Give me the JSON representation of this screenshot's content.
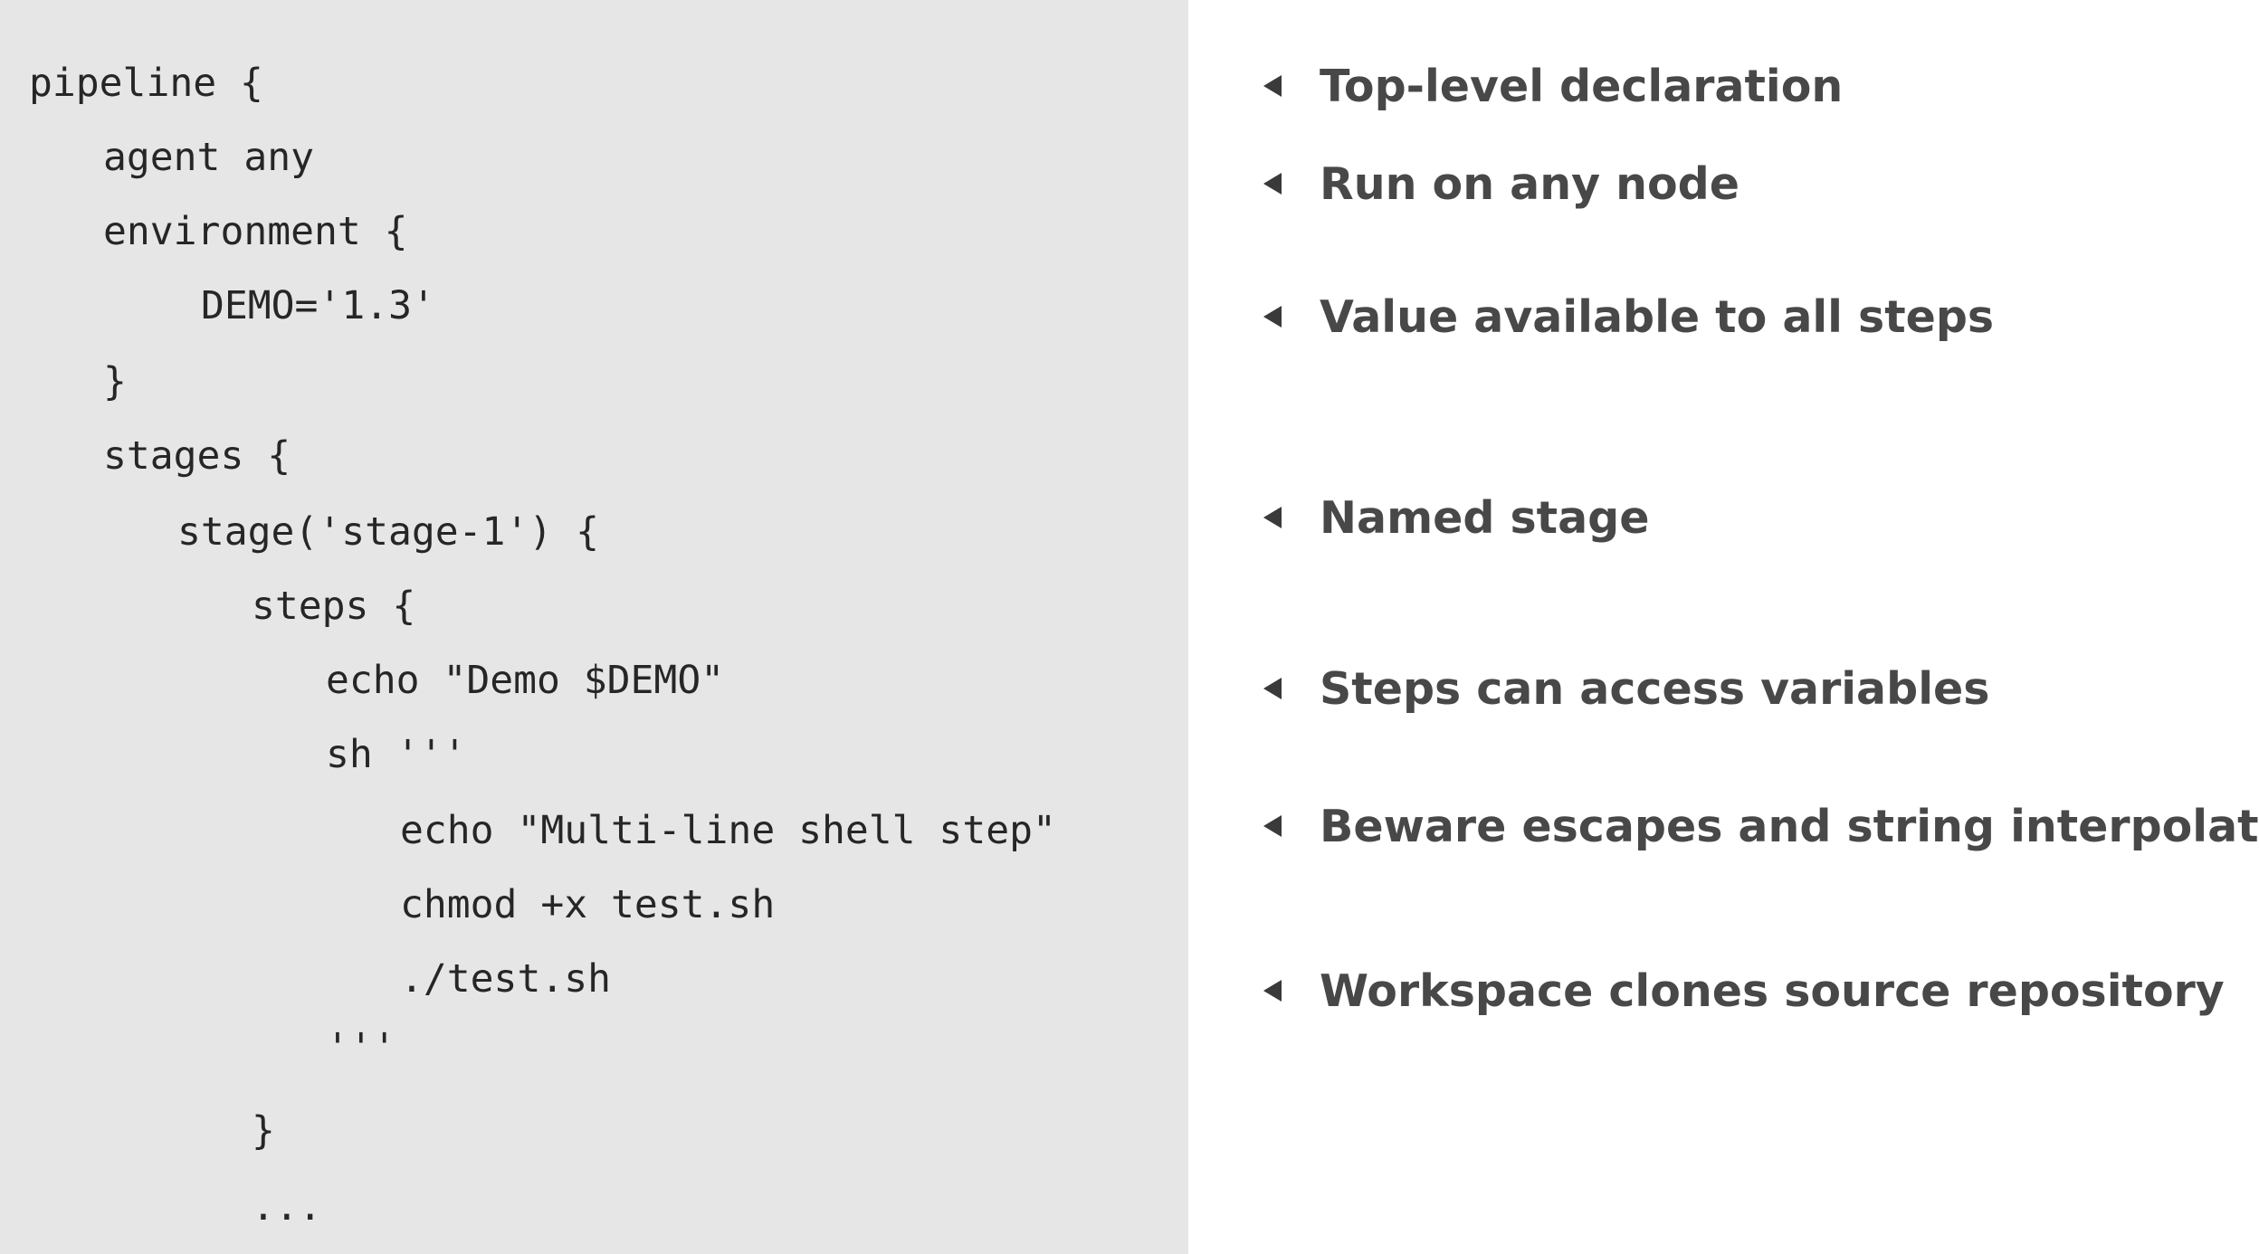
{
  "code": {
    "lines": [
      "pipeline {",
      "agent any",
      "environment {",
      "DEMO='1.3'",
      "}",
      "stages {",
      "stage('stage-1') {",
      "steps {",
      "echo \"Demo $DEMO\"",
      "sh '''",
      "echo \"Multi-line shell step\"",
      "chmod +x test.sh",
      "./test.sh",
      "'''",
      "}",
      "..."
    ]
  },
  "annotations": [
    {
      "text": "Top-level declaration",
      "icon": "arrow-left-icon"
    },
    {
      "text": "Run on any node",
      "icon": "arrow-left-icon"
    },
    {
      "text": "Value available to all steps",
      "icon": "arrow-left-icon"
    },
    {
      "text": "Named stage",
      "icon": "arrow-left-icon"
    },
    {
      "text": "Steps can access variables",
      "icon": "arrow-left-icon"
    },
    {
      "text": "Beware escapes and string interpolation",
      "icon": "arrow-left-icon"
    },
    {
      "text": "Workspace clones source repository",
      "icon": "arrow-left-icon"
    }
  ],
  "colors": {
    "code_background": "#e6e6e6",
    "code_text": "#262626",
    "note_text": "#484848",
    "arrow": "#3a3a3a"
  }
}
